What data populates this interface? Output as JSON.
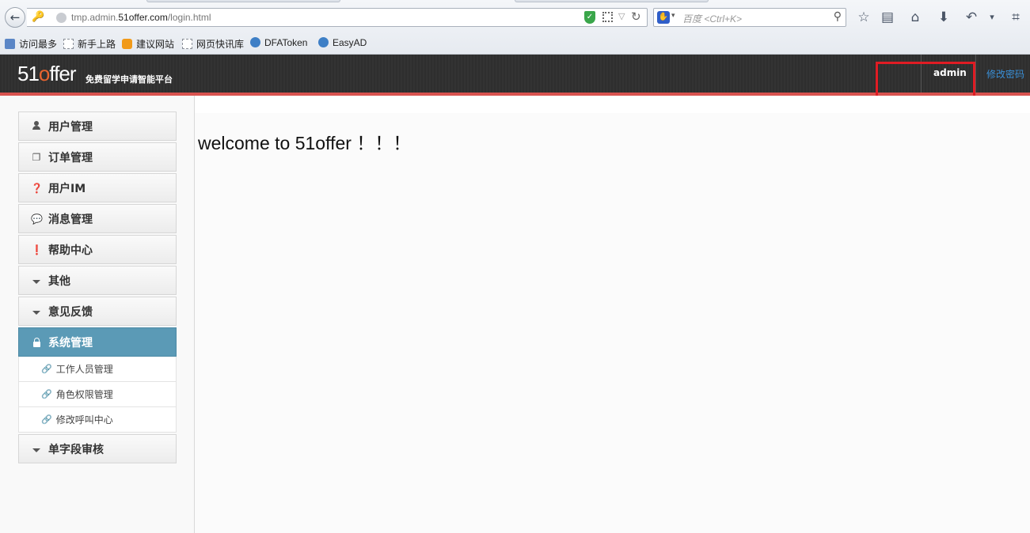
{
  "browser": {
    "url_prefix": "tmp.admin.",
    "url_domain": "51offer.com",
    "url_path": "/login.html",
    "search_placeholder": "百度 <Ctrl+K>",
    "bookmarks": [
      "访问最多",
      "新手上路",
      "建议网站",
      "网页快讯库",
      "DFAToken",
      "EasyAD"
    ]
  },
  "header": {
    "logo_text_a": "51",
    "logo_text_b": "o",
    "logo_text_c": "ffer",
    "tagline": "免费留学申请智能平台",
    "user": "admin",
    "change_password": "修改密码",
    "accent_color": "#d9534f"
  },
  "sidebar": {
    "items": [
      {
        "label": "用户管理",
        "icon": "user-icon"
      },
      {
        "label": "订单管理",
        "icon": "copy-icon"
      },
      {
        "label": "用户IM",
        "icon": "question-icon"
      },
      {
        "label": "消息管理",
        "icon": "comment-icon"
      },
      {
        "label": "帮助中心",
        "icon": "exclamation-icon"
      },
      {
        "label": "其他",
        "icon": "caret-down-icon"
      },
      {
        "label": "意见反馈",
        "icon": "caret-down-icon"
      },
      {
        "label": "系统管理",
        "icon": "lock-icon",
        "active": true
      },
      {
        "label": "单字段审核",
        "icon": "caret-down-icon"
      }
    ],
    "sub_items": [
      "工作人员管理",
      "角色权限管理",
      "修改呼叫中心"
    ],
    "active_color": "#5b9ab6"
  },
  "main": {
    "welcome": "welcome to 51offer ！！！"
  }
}
